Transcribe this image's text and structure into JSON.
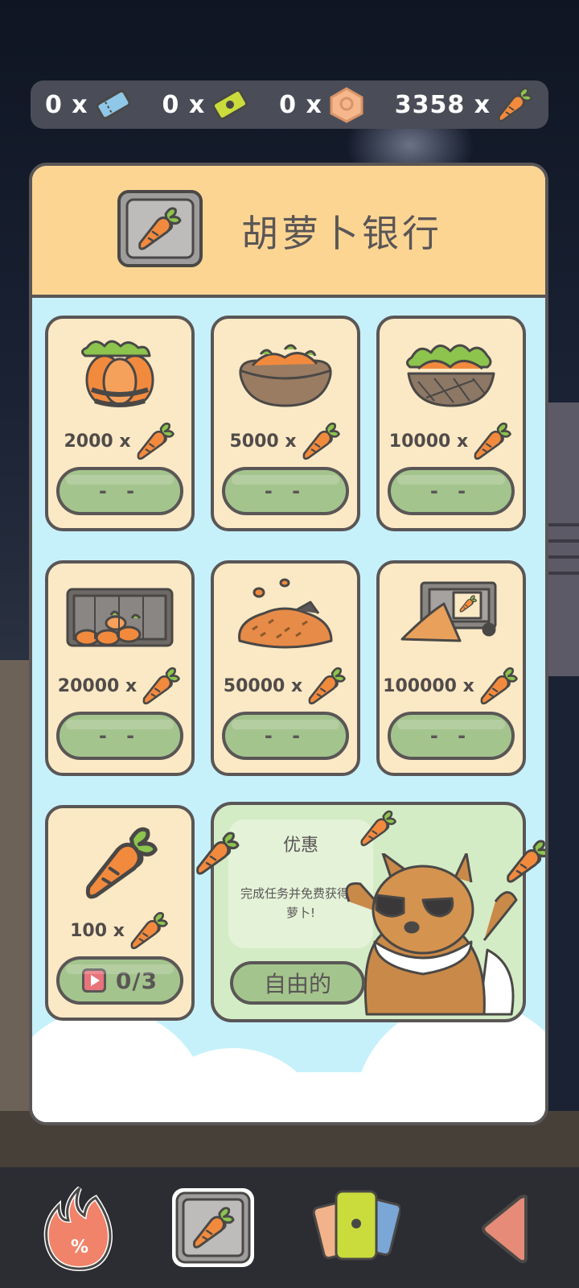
{
  "currencies": [
    {
      "amount": "0 x",
      "icon": "blue-ticket-icon"
    },
    {
      "amount": "0 x",
      "icon": "green-ticket-icon"
    },
    {
      "amount": "0 x",
      "icon": "orange-token-icon"
    },
    {
      "amount": "3358 x",
      "icon": "carrot-icon"
    }
  ],
  "panel": {
    "title": "胡萝卜银行",
    "icon": "carrot-safe-icon"
  },
  "packs": [
    {
      "art": "carrot-bundle-icon",
      "price": "2000 x",
      "button": "- -"
    },
    {
      "art": "carrot-sack-icon",
      "price": "5000 x",
      "button": "- -"
    },
    {
      "art": "carrot-basket-icon",
      "price": "10000 x",
      "button": "- -"
    },
    {
      "art": "carrot-crate-icon",
      "price": "20000 x",
      "button": "- -"
    },
    {
      "art": "carrot-pile-icon",
      "price": "50000 x",
      "button": "- -"
    },
    {
      "art": "carrot-truck-icon",
      "price": "100000 x",
      "button": "- -"
    }
  ],
  "ad_pack": {
    "art": "big-carrot-icon",
    "price": "100 x",
    "button": "0/3",
    "icon": "video-play-icon"
  },
  "offer": {
    "title": "优惠",
    "description": "完成任务并免费获得胡萝卜!",
    "button": "自由的"
  },
  "nav": [
    {
      "icon": "fire-sale-icon"
    },
    {
      "icon": "carrot-bank-icon"
    },
    {
      "icon": "ticket-cards-icon"
    },
    {
      "icon": "back-arrow-icon"
    }
  ],
  "colors": {
    "header": "#fdd593",
    "body": "#c6f1fb",
    "card": "#fbe9c5",
    "button": "#a4c48d",
    "outline": "#5a5656"
  }
}
